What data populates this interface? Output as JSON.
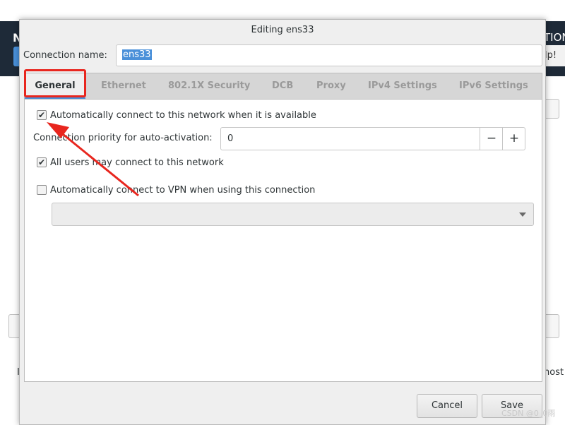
{
  "background": {
    "left_header_text": "N",
    "right_header_text": "TION",
    "right_button_label": "lp!",
    "left_text": "I",
    "right_text": "host"
  },
  "dialog": {
    "title": "Editing ens33",
    "connection_name_label": "Connection name:",
    "connection_name_value": "ens33",
    "tabs": [
      {
        "label": "General",
        "active": true
      },
      {
        "label": "Ethernet",
        "active": false
      },
      {
        "label": "802.1X Security",
        "active": false
      },
      {
        "label": "DCB",
        "active": false
      },
      {
        "label": "Proxy",
        "active": false
      },
      {
        "label": "IPv4 Settings",
        "active": false
      },
      {
        "label": "IPv6 Settings",
        "active": false
      }
    ],
    "general": {
      "auto_connect": {
        "label": "Automatically connect to this network when it is available",
        "checked": true
      },
      "priority": {
        "label": "Connection priority for auto-activation:",
        "value": "0",
        "decrement": "−",
        "increment": "+"
      },
      "all_users": {
        "label": "All users may connect to this network",
        "checked": true
      },
      "auto_vpn": {
        "label": "Automatically connect to VPN when using this connection",
        "checked": false
      },
      "vpn_select_value": ""
    },
    "buttons": {
      "cancel": "Cancel",
      "save": "Save"
    }
  },
  "annotation": {
    "color": "#e8261e"
  },
  "watermark": "CSDN @0_0雨"
}
